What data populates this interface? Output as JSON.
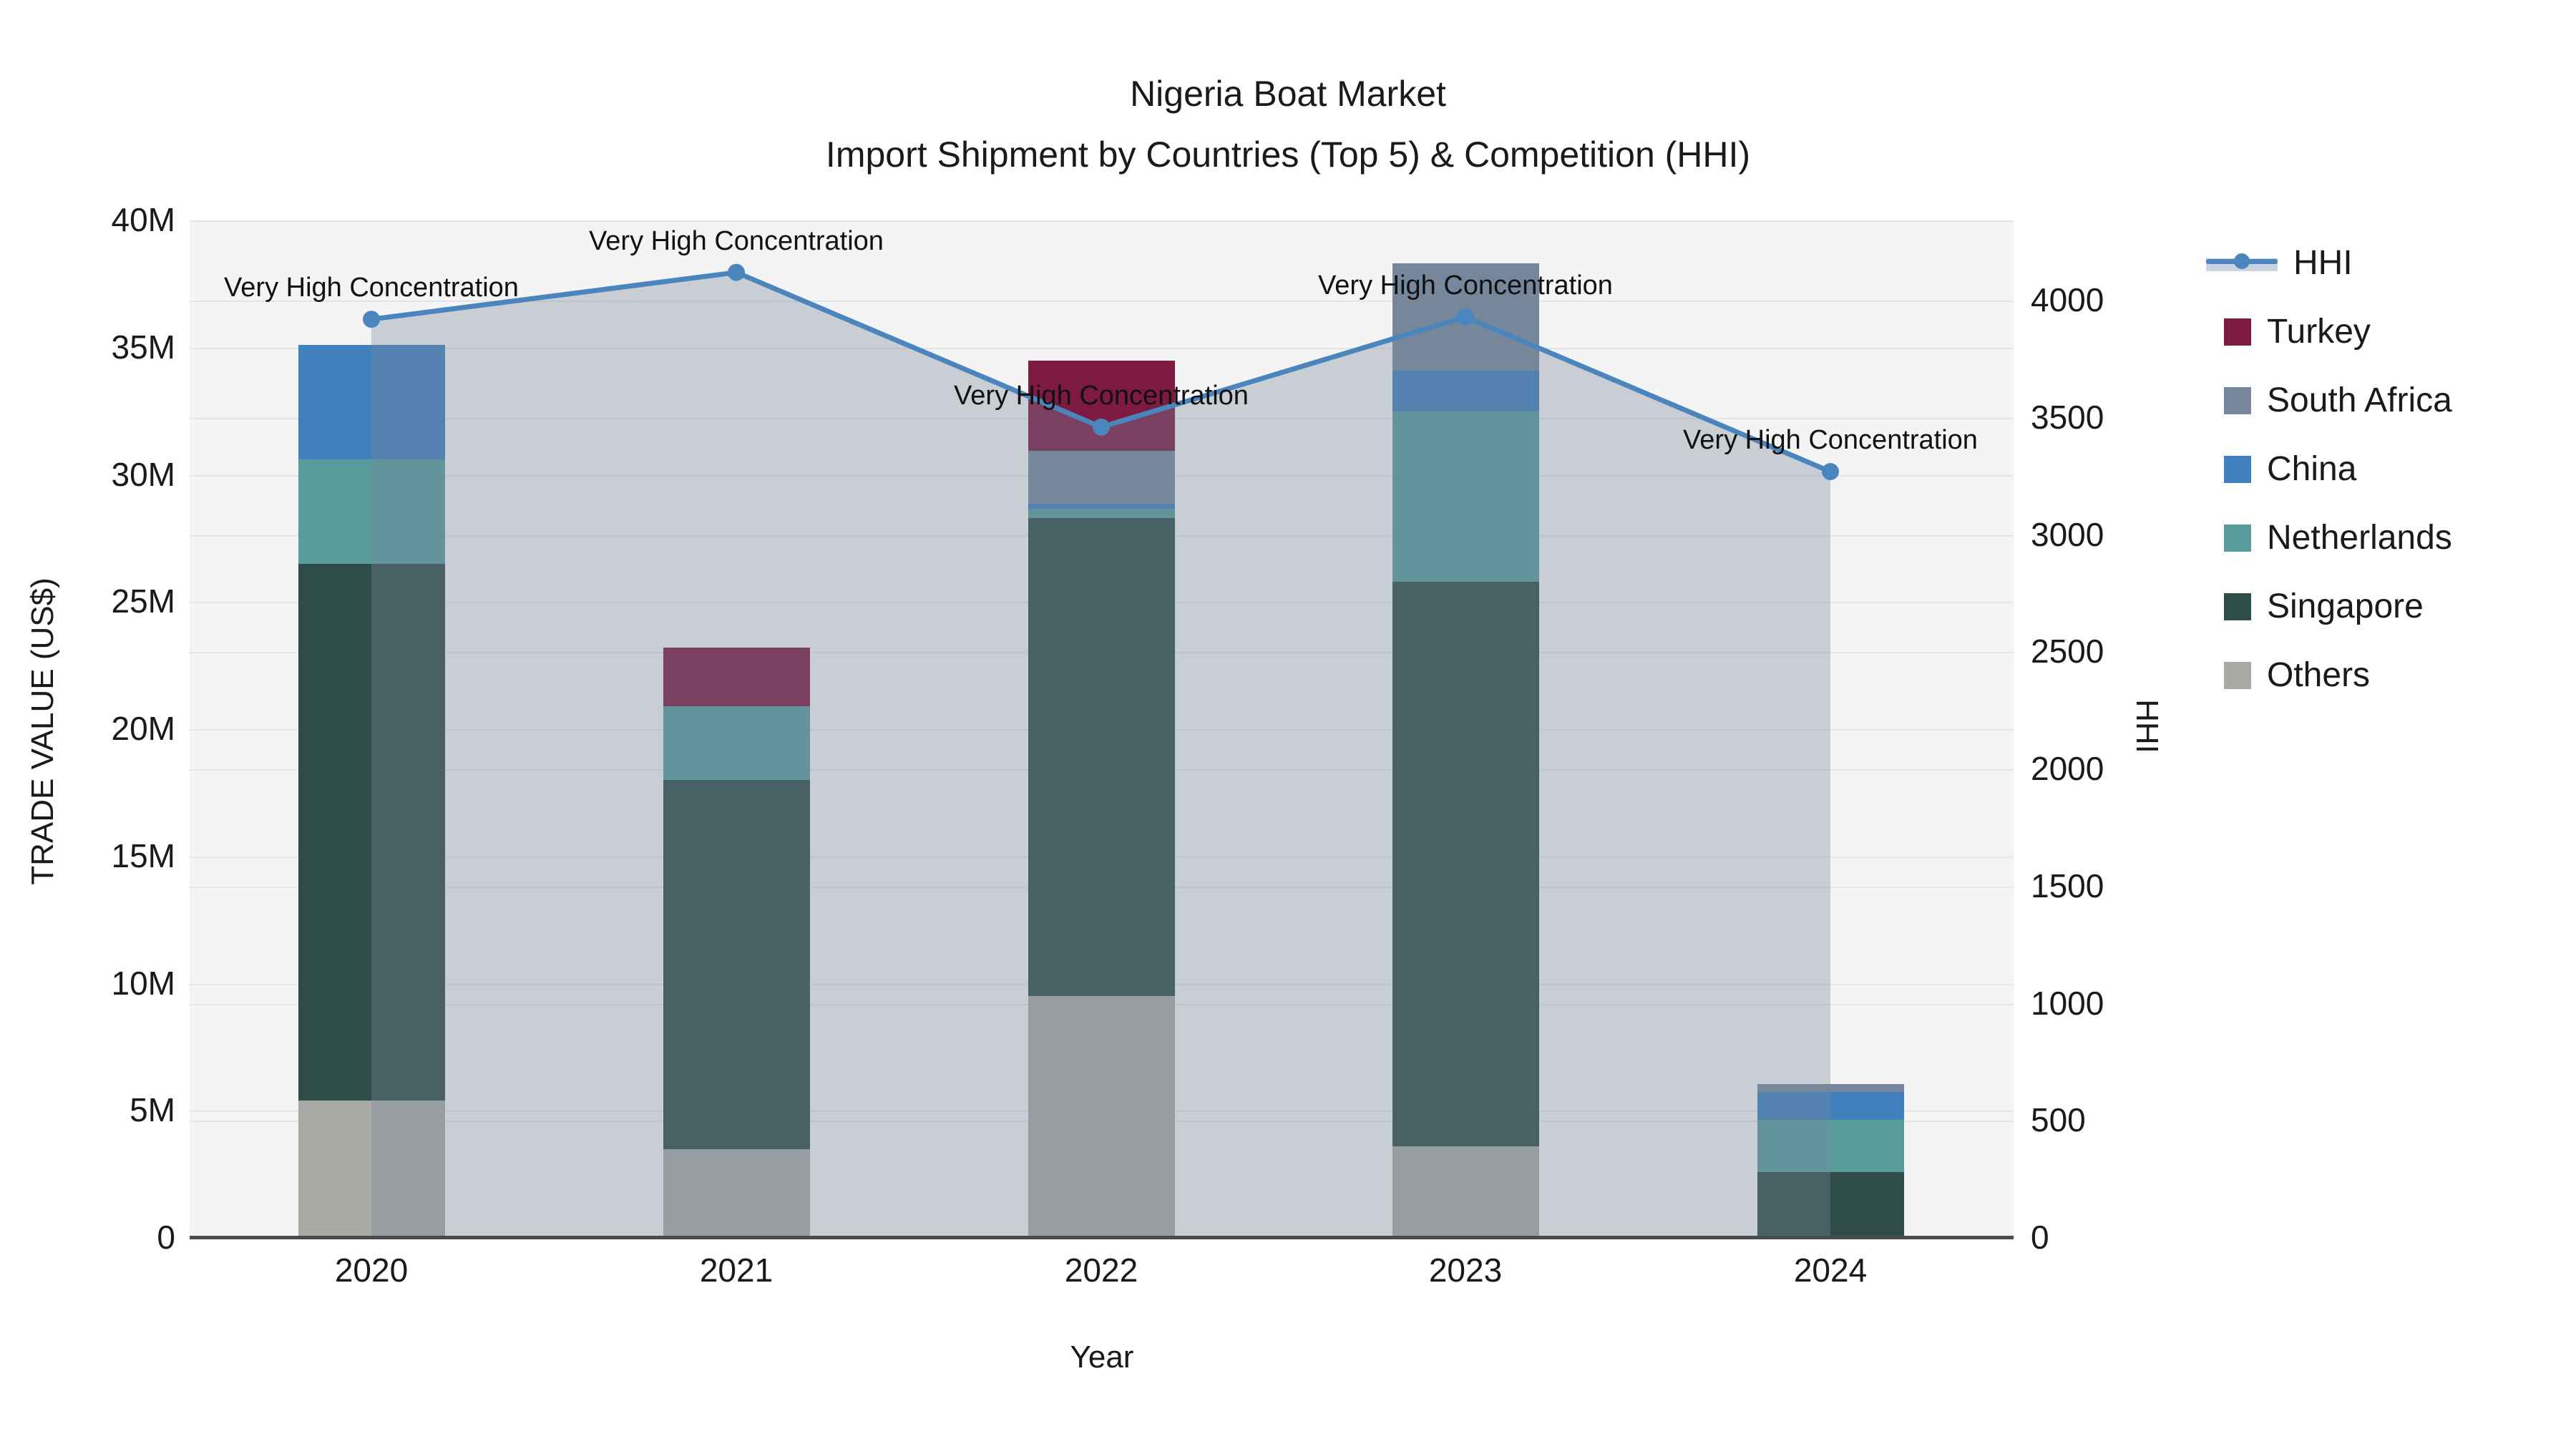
{
  "title": {
    "line1": "Nigeria Boat Market",
    "line2": "Import Shipment by Countries (Top 5) & Competition (HHI)"
  },
  "axes": {
    "y_left_title": "TRADE VALUE (US$)",
    "y_right_title": "HHI",
    "x_title": "Year",
    "y_left_ticks": [
      "0",
      "5M",
      "10M",
      "15M",
      "20M",
      "25M",
      "30M",
      "35M",
      "40M"
    ],
    "y_right_ticks": [
      "0",
      "500",
      "1000",
      "1500",
      "2000",
      "2500",
      "3000",
      "3500",
      "4000"
    ]
  },
  "legend": {
    "hhi_label": "HHI",
    "entries": [
      {
        "label": "Turkey",
        "color": "#7d1a42"
      },
      {
        "label": "South Africa",
        "color": "#76879b"
      },
      {
        "label": "China",
        "color": "#3f80bd"
      },
      {
        "label": "Netherlands",
        "color": "#5a9c9b"
      },
      {
        "label": "Singapore",
        "color": "#2f4d48"
      },
      {
        "label": "Others",
        "color": "#a9a9a6"
      }
    ]
  },
  "annotation_text": "Very High Concentration",
  "chart_data": {
    "type": "bar",
    "subtype": "stacked-bars-with-line",
    "title": "Nigeria Boat Market — Import Shipment by Countries (Top 5) & Competition (HHI)",
    "categories": [
      "2020",
      "2021",
      "2022",
      "2023",
      "2024"
    ],
    "xlabel": "Year",
    "ylabel_left": "TRADE VALUE (US$)",
    "ylabel_right": "HHI",
    "ylim_left_millions": [
      0,
      40
    ],
    "ylim_right": [
      0,
      4388
    ],
    "grid": true,
    "legend_position": "right",
    "series": [
      {
        "name": "Others",
        "color": "#a9a9a6",
        "values_millions": [
          5.4,
          3.5,
          9.5,
          3.6,
          0
        ]
      },
      {
        "name": "Singapore",
        "color": "#2f4d48",
        "values_millions": [
          21.1,
          14.5,
          18.8,
          22.2,
          2.6
        ]
      },
      {
        "name": "Netherlands",
        "color": "#5a9c9b",
        "values_millions": [
          4.1,
          2.9,
          0.35,
          6.7,
          2.05
        ]
      },
      {
        "name": "China",
        "color": "#3f80bd",
        "values_millions": [
          4.5,
          0,
          0.2,
          1.6,
          1.1
        ]
      },
      {
        "name": "South Africa",
        "color": "#76879b",
        "values_millions": [
          0,
          0,
          2.1,
          4.2,
          0.3
        ]
      },
      {
        "name": "Turkey",
        "color": "#7d1a42",
        "values_millions": [
          0,
          2.3,
          3.55,
          0,
          0
        ]
      }
    ],
    "line_series": {
      "name": "HHI",
      "color": "#4a86bd",
      "area_fill": "rgba(119,134,154,0.35)",
      "values": [
        3920,
        4120,
        3460,
        3930,
        3270
      ],
      "point_annotations": [
        "Very High Concentration",
        "Very High Concentration",
        "Very High Concentration",
        "Very High Concentration",
        "Very High Concentration"
      ]
    }
  }
}
